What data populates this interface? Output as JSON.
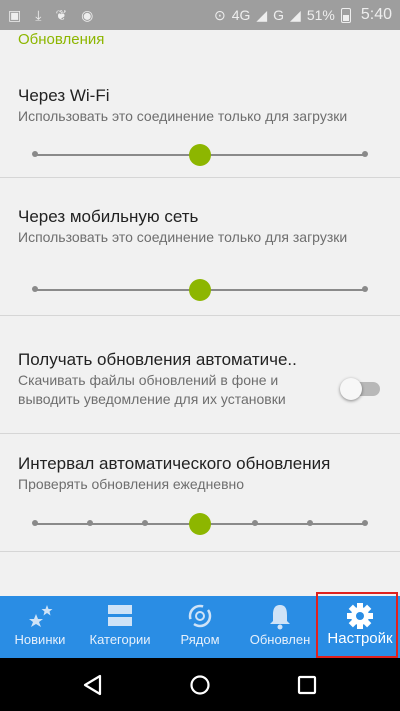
{
  "status_bar": {
    "network": "4G",
    "network_secondary": "G",
    "battery": "51%",
    "time": "5:40"
  },
  "settings": {
    "section_title": "Обновления",
    "wifi": {
      "title": "Через Wi-Fi",
      "summary": "Использовать это соединение только для загрузки",
      "slider_stops": 3,
      "slider_selected_index": 1
    },
    "mobile": {
      "title": "Через мобильную сеть",
      "summary": "Использовать это соединение только для загрузки",
      "slider_stops": 3,
      "slider_selected_index": 1
    },
    "auto_update": {
      "title": "Получать обновления автоматиче..",
      "summary": "Скачивать файлы обновлений в фоне и выводить уведомление для их установки",
      "enabled": false
    },
    "interval": {
      "title": "Интервал автоматического обновления",
      "summary": "Проверять обновления ежедневно",
      "slider_stops": 7,
      "slider_selected_index": 3
    }
  },
  "bottom_nav": {
    "items": [
      {
        "label": "Новинки",
        "icon": "sparkle-star-icon"
      },
      {
        "label": "Категории",
        "icon": "categories-icon"
      },
      {
        "label": "Рядом",
        "icon": "nearby-swap-icon"
      },
      {
        "label": "Обновлен",
        "icon": "bell-icon"
      },
      {
        "label": "Настройк",
        "icon": "gear-icon"
      }
    ],
    "active_index": 4
  },
  "colors": {
    "accent": "#8db600",
    "nav_background": "#2a8de4",
    "highlight": "#e0211d"
  }
}
